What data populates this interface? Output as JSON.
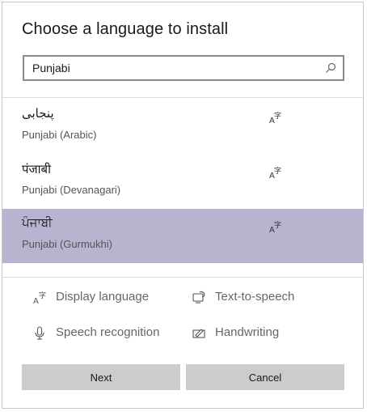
{
  "dialog": {
    "title": "Choose a language to install",
    "search": {
      "value": "Punjabi",
      "icon": "search-icon"
    },
    "languages": [
      {
        "native": "پنجابی",
        "english": "Punjabi (Arabic)",
        "selected": false,
        "icon": "display-language-icon"
      },
      {
        "native": "पंजाबी",
        "english": "Punjabi (Devanagari)",
        "selected": false,
        "icon": "display-language-icon"
      },
      {
        "native": "ਪੰਜਾਬੀ",
        "english": "Punjabi (Gurmukhi)",
        "selected": true,
        "icon": "display-language-icon"
      }
    ],
    "features": {
      "display_language": "Display language",
      "text_to_speech": "Text-to-speech",
      "speech_recognition": "Speech recognition",
      "handwriting": "Handwriting"
    },
    "buttons": {
      "next": "Next",
      "cancel": "Cancel"
    },
    "colors": {
      "selected_bg": "#b7b4d0",
      "button_bg": "#cccccc"
    }
  }
}
